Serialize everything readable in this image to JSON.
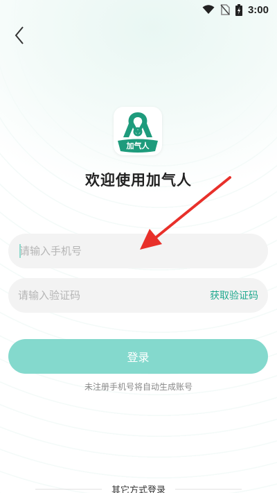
{
  "status_bar": {
    "time": "3:00",
    "icons": [
      "wifi-icon",
      "no-sim-icon",
      "battery-charging-icon"
    ]
  },
  "header": {
    "back_icon": "chevron-left-icon"
  },
  "logo": {
    "text": "加气人",
    "colors": {
      "primary": "#1e9b7c"
    }
  },
  "welcome_text": "欢迎使用加气人",
  "phone_field": {
    "placeholder": "请输入手机号",
    "value": ""
  },
  "code_field": {
    "placeholder": "请输入验证码",
    "value": "",
    "get_code_label": "获取验证码"
  },
  "login_button": {
    "label": "登录",
    "color": "#84d9cd"
  },
  "notice_text": "未注册手机号将自动生成账号",
  "other_login": {
    "label": "其它方式登录"
  },
  "annotation": {
    "arrow_color": "#e8302a"
  }
}
